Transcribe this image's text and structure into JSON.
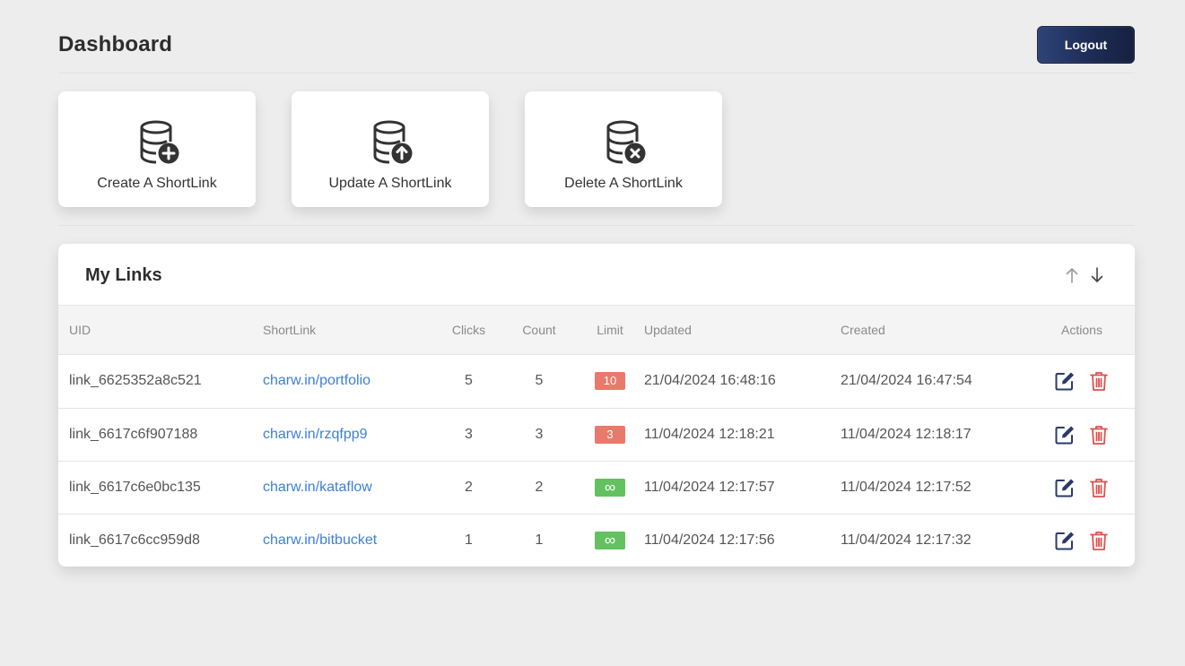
{
  "header": {
    "title": "Dashboard",
    "logout_label": "Logout"
  },
  "action_cards": [
    {
      "label": "Create A ShortLink",
      "icon": "database-plus-icon"
    },
    {
      "label": "Update A ShortLink",
      "icon": "database-arrow-up-icon"
    },
    {
      "label": "Delete A ShortLink",
      "icon": "database-x-icon"
    }
  ],
  "links_panel": {
    "title": "My Links",
    "sort_icons": [
      "arrow-up-icon",
      "arrow-down-icon"
    ],
    "columns": [
      "UID",
      "ShortLink",
      "Clicks",
      "Count",
      "Limit",
      "Updated",
      "Created",
      "Actions"
    ],
    "rows": [
      {
        "uid": "link_6625352a8c521",
        "shortlink": "charw.in/portfolio",
        "clicks": "5",
        "count": "5",
        "limit": "10",
        "limit_status": "reached",
        "updated": "21/04/2024 16:48:16",
        "created": "21/04/2024 16:47:54"
      },
      {
        "uid": "link_6617c6f907188",
        "shortlink": "charw.in/rzqfpp9",
        "clicks": "3",
        "count": "3",
        "limit": "3",
        "limit_status": "reached",
        "updated": "11/04/2024 12:18:21",
        "created": "11/04/2024 12:18:17"
      },
      {
        "uid": "link_6617c6e0bc135",
        "shortlink": "charw.in/kataflow",
        "clicks": "2",
        "count": "2",
        "limit": "∞",
        "limit_status": "unlimited",
        "updated": "11/04/2024 12:17:57",
        "created": "11/04/2024 12:17:52"
      },
      {
        "uid": "link_6617c6cc959d8",
        "shortlink": "charw.in/bitbucket",
        "clicks": "1",
        "count": "1",
        "limit": "∞",
        "limit_status": "unlimited",
        "updated": "11/04/2024 12:17:56",
        "created": "11/04/2024 12:17:32"
      }
    ]
  },
  "colors": {
    "background": "#ededed",
    "logout_button": "#1d2c56",
    "link": "#3c7fd9",
    "badge_limited": "#e97a6b",
    "badge_unlimited": "#63c15f",
    "edit_icon": "#2a3b6b",
    "delete_icon": "#d9534f"
  }
}
